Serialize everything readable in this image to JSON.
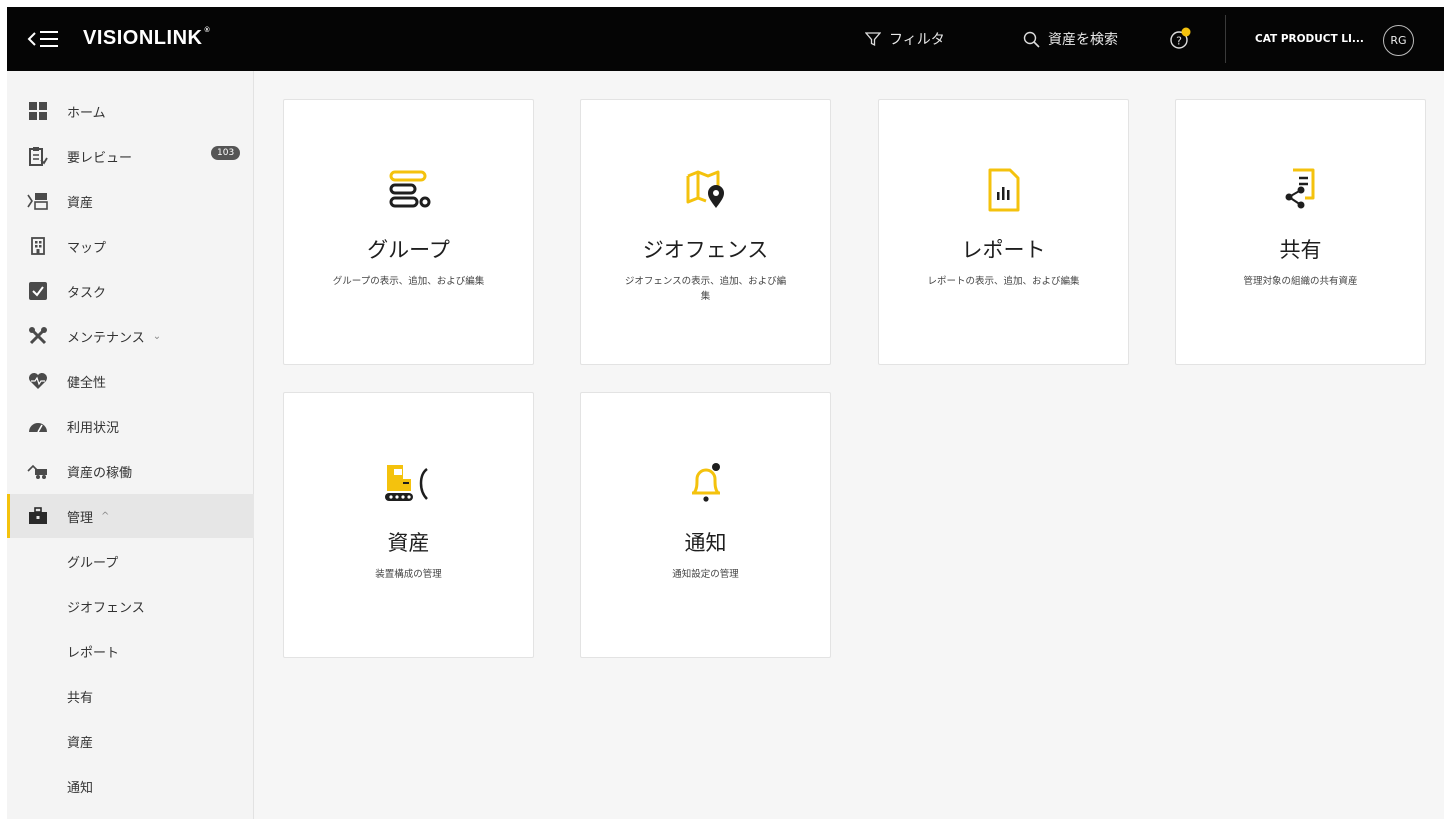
{
  "header": {
    "logo_text": "VISIONLINK",
    "logo_mark": "®",
    "filter_label": "フィルタ",
    "search_label": "資産を検索",
    "account_label": "CAT PRODUCT LI...",
    "avatar_initials": "RG",
    "notification_dot_color": "#f4c20d"
  },
  "sidebar": {
    "items": [
      {
        "label": "ホーム",
        "icon": "grid-icon"
      },
      {
        "label": "要レビュー",
        "icon": "clipboard-icon",
        "badge": "103"
      },
      {
        "label": "資産",
        "icon": "assets-icon"
      },
      {
        "label": "マップ",
        "icon": "map-building-icon"
      },
      {
        "label": "タスク",
        "icon": "task-check-icon"
      },
      {
        "label": "メンテナンス",
        "icon": "tools-icon",
        "chevron": "⌄"
      },
      {
        "label": "健全性",
        "icon": "heart-icon"
      },
      {
        "label": "利用状況",
        "icon": "gauge-icon"
      },
      {
        "label": "資産の稼働",
        "icon": "truck-icon"
      },
      {
        "label": "管理",
        "icon": "briefcase-icon",
        "chevron": "^",
        "active": true
      }
    ],
    "sub_items": [
      "グループ",
      "ジオフェンス",
      "レポート",
      "共有",
      "資産",
      "通知"
    ]
  },
  "cards": [
    {
      "title": "グループ",
      "description": "グループの表示、追加、および編集",
      "icon": "group-list-icon"
    },
    {
      "title": "ジオフェンス",
      "description": "ジオフェンスの表示、追加、および編集",
      "icon": "map-pin-icon"
    },
    {
      "title": "レポート",
      "description": "レポートの表示、追加、および編集",
      "icon": "report-chart-icon"
    },
    {
      "title": "共有",
      "description": "管理対象の組織の共有資産",
      "icon": "share-document-icon"
    },
    {
      "title": "資産",
      "description": "装置構成の管理",
      "icon": "excavator-icon"
    },
    {
      "title": "通知",
      "description": "通知設定の管理",
      "icon": "bell-icon"
    }
  ],
  "colors": {
    "accent": "#f4c20d",
    "topbar": "#050505",
    "sidebar": "#f4f4f4",
    "content_bg": "#f6f6f6"
  }
}
